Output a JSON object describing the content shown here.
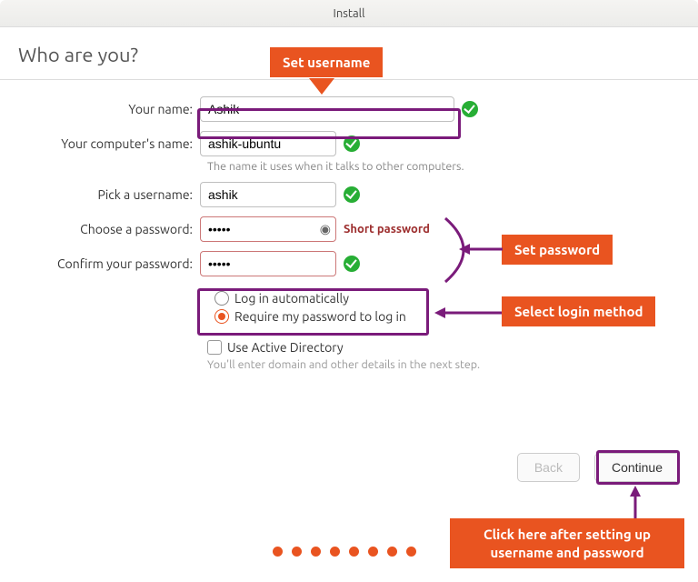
{
  "window": {
    "title": "Install"
  },
  "heading": "Who are you?",
  "labels": {
    "your_name": "Your name:",
    "computer_name": "Your computer's name:",
    "username": "Pick a username:",
    "password": "Choose a password:",
    "confirm": "Confirm your password:"
  },
  "fields": {
    "your_name": "Ashik",
    "computer_name": "ashik-ubuntu",
    "username": "ashik",
    "password": "•••••",
    "confirm": "•••••"
  },
  "hints": {
    "computer_name": "The name it uses when it talks to other computers.",
    "short_password": "Short password",
    "ad": "You'll enter domain and other details in the next step."
  },
  "login": {
    "auto": "Log in automatically",
    "require": "Require my password to log in",
    "selected": "require"
  },
  "ad": {
    "label": "Use Active Directory",
    "checked": false
  },
  "buttons": {
    "back": "Back",
    "continue": "Continue"
  },
  "annotations": {
    "set_username": "Set username",
    "set_password": "Set password",
    "select_login": "Select login method",
    "continue_hint": "Click here after setting up username and password"
  }
}
